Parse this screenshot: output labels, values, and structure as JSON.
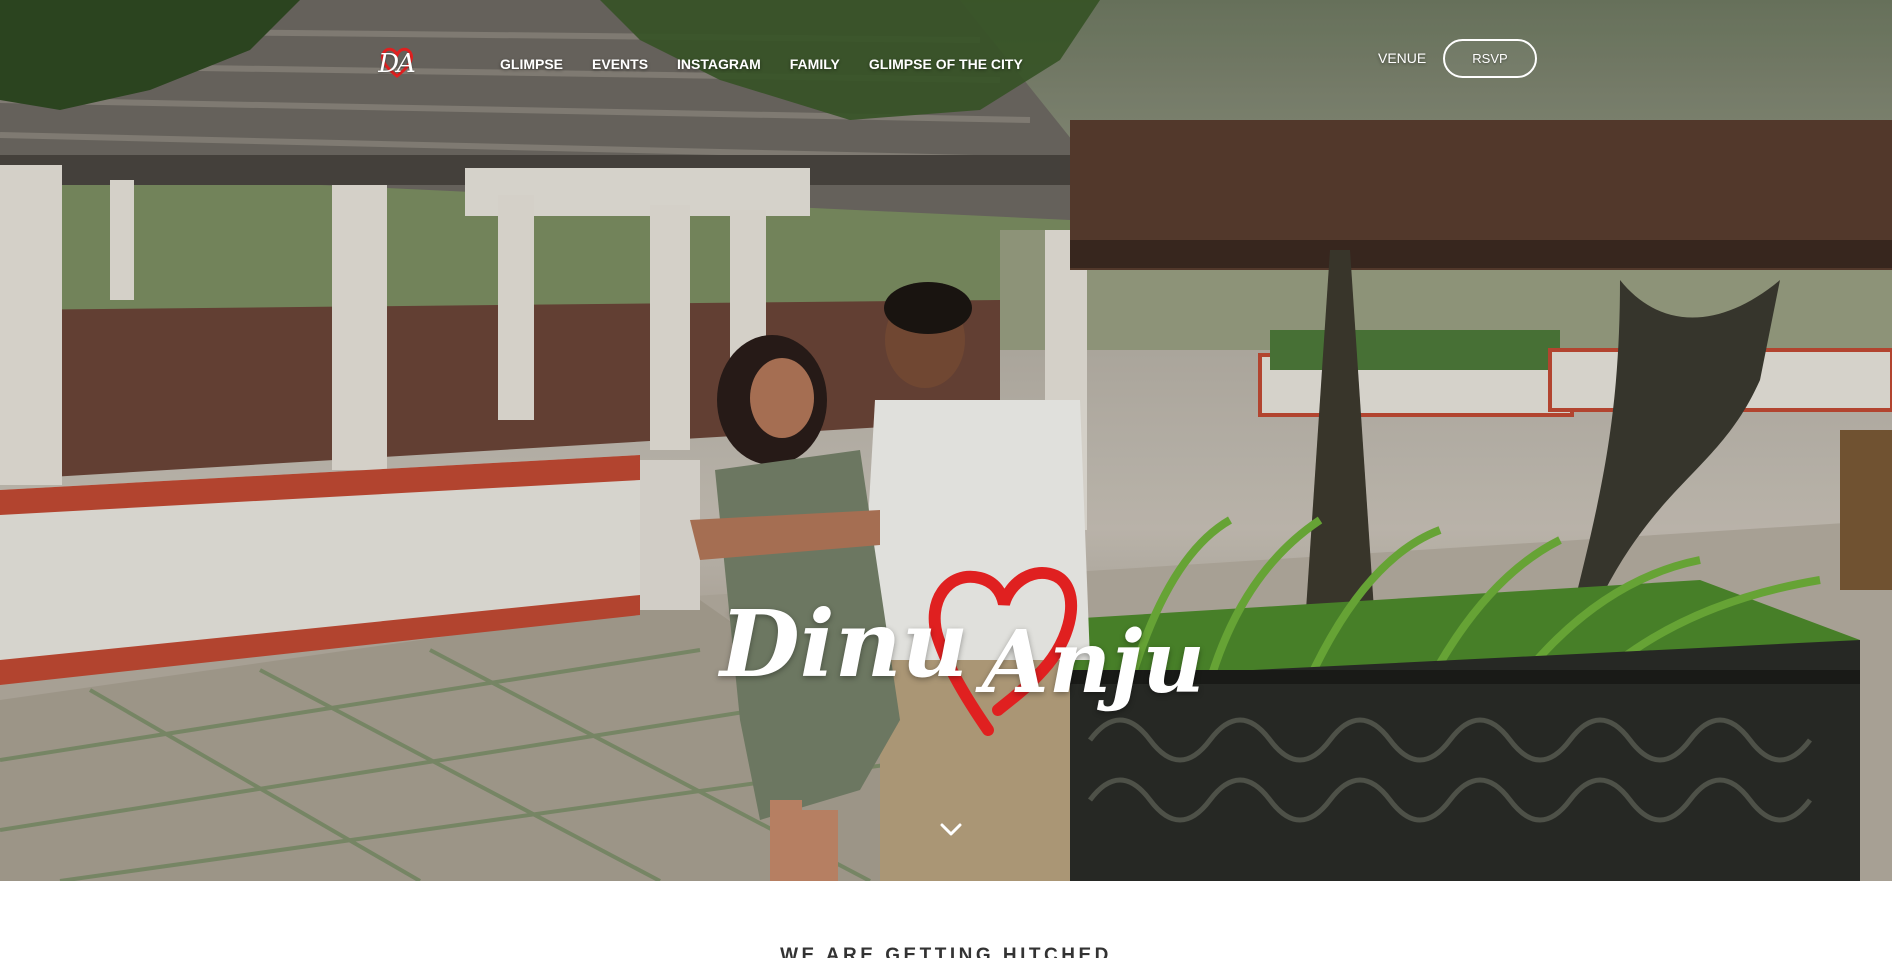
{
  "site": {
    "logo_text": "DA"
  },
  "nav": {
    "items": [
      {
        "label": "GLIMPSE"
      },
      {
        "label": "EVENTS"
      },
      {
        "label": "INSTAGRAM"
      },
      {
        "label": "FAMILY"
      },
      {
        "label": "GLIMPSE OF THE CITY"
      }
    ],
    "venue_label": "VENUE",
    "rsvp_label": "RSVP"
  },
  "hero": {
    "name_1": "Dinu",
    "name_2": "Anju",
    "heart_color": "#e02020",
    "scroll_icon": "chevron-down-icon"
  },
  "intro": {
    "heading": "WE ARE GETTING HITCHED"
  },
  "colors": {
    "accent_red": "#e02020",
    "nav_text": "#ffffff",
    "heading_text": "#333333"
  }
}
